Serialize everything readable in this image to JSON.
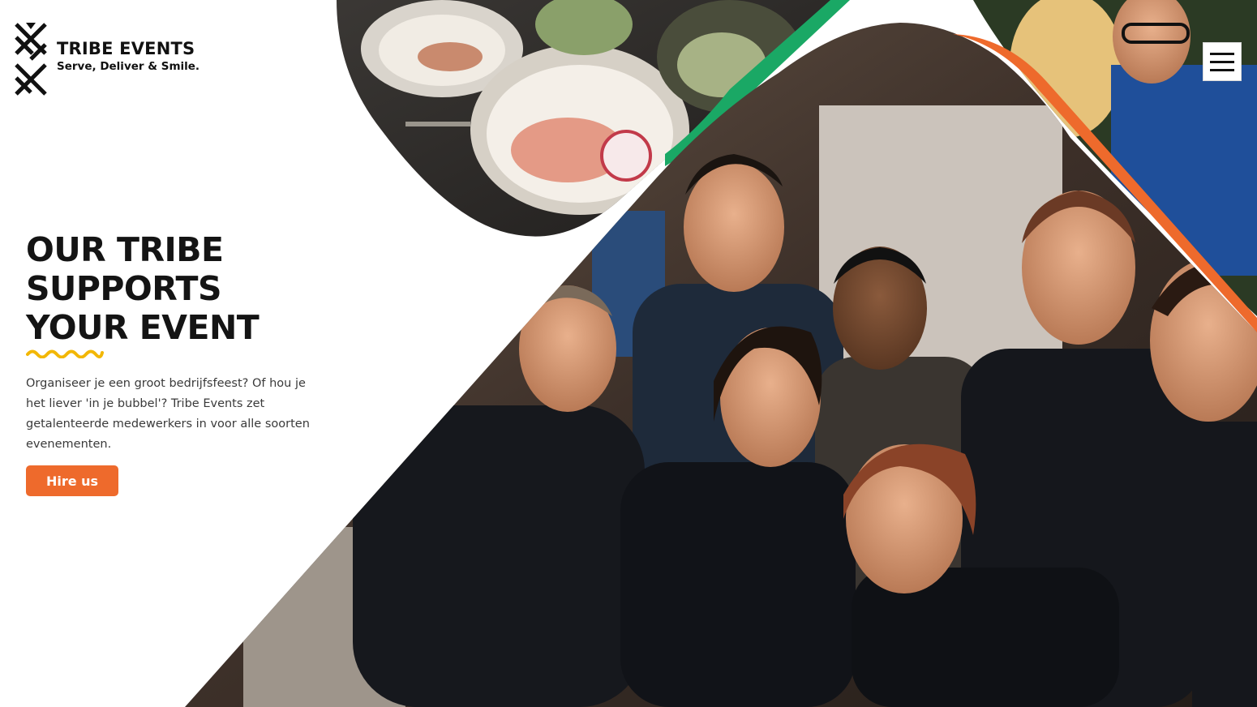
{
  "brand": {
    "name": "TRIBE EVENTS",
    "tagline": "Serve, Deliver & Smile."
  },
  "hero": {
    "headline_lines": [
      "OUR TRIBE",
      "SUPPORTS",
      "YOUR EVENT"
    ],
    "intro": "Organiseer je een groot bedrijfsfeest? Of hou je het liever 'in je bubbel'? Tribe Events zet getalenteerde medewerkers in voor alle soorten evenementen.",
    "cta_label": "Hire us"
  },
  "header": {
    "menu_icon": "hamburger-menu-icon"
  },
  "colors": {
    "accent_orange": "#ee6a2c",
    "accent_green": "#1aa865",
    "accent_yellow": "#f2b705",
    "text_dark": "#141414"
  },
  "images": {
    "food_photo": "plated food bowls photo",
    "team_photo": "smiling event staff team photo"
  }
}
